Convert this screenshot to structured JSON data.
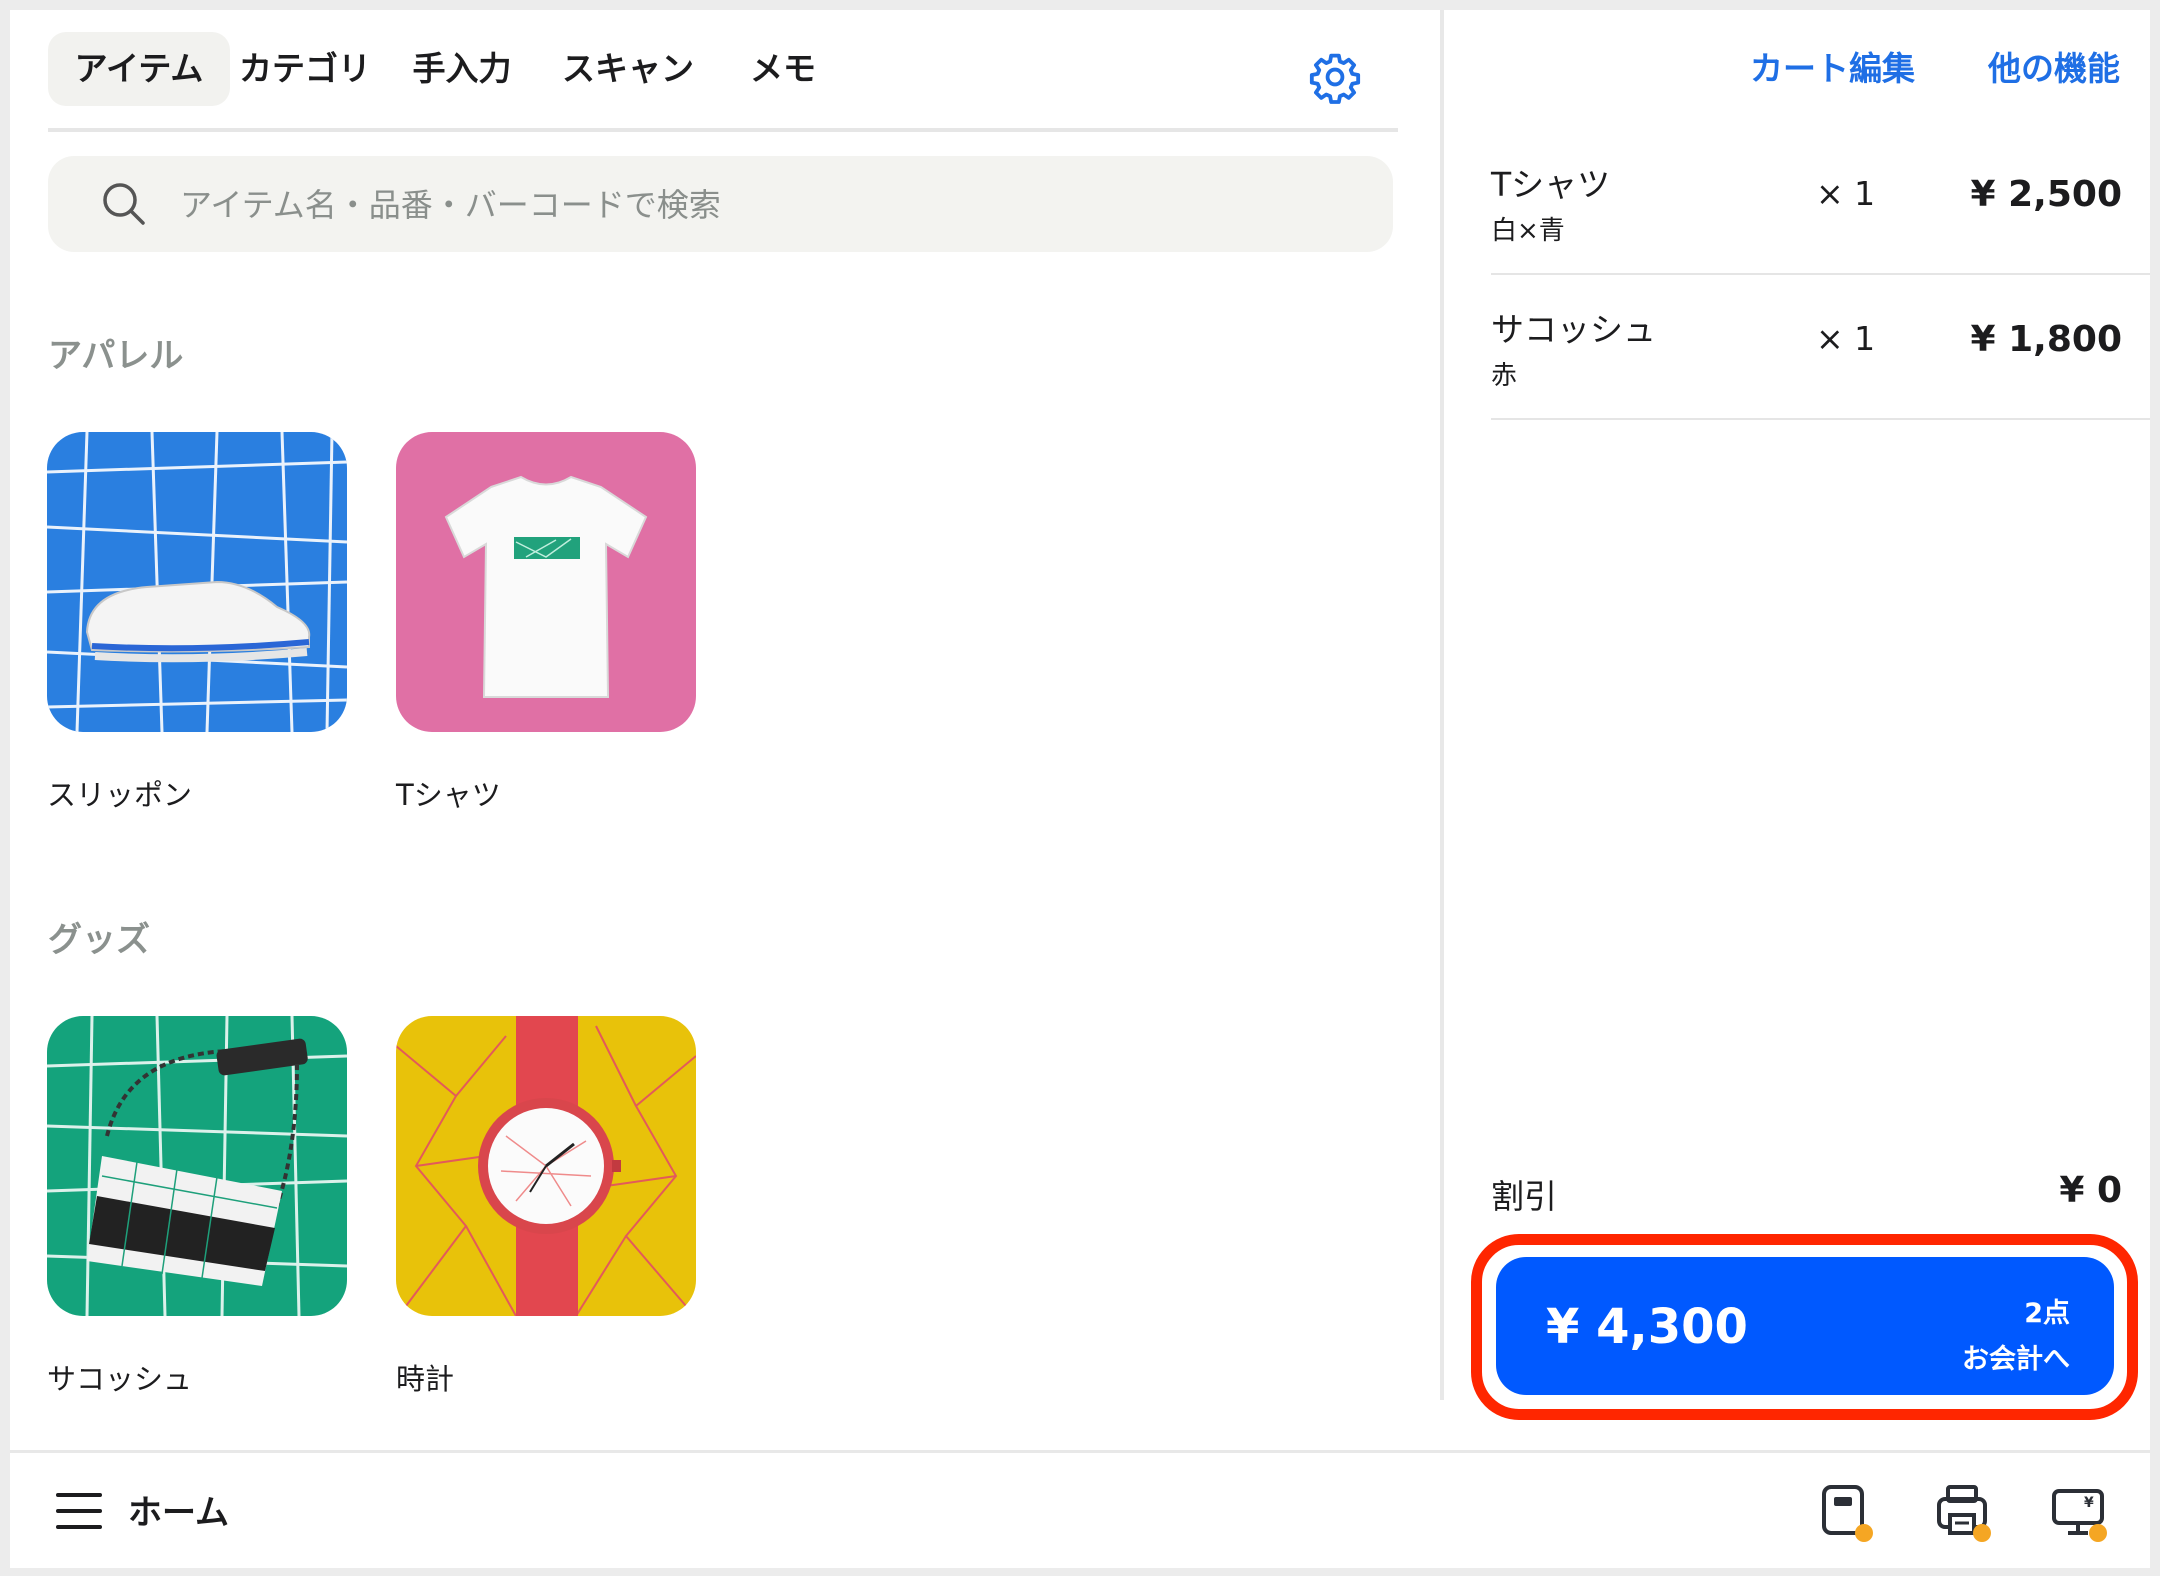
{
  "tabs": [
    {
      "label": "アイテム",
      "active": true
    },
    {
      "label": "カテゴリ"
    },
    {
      "label": "手入力"
    },
    {
      "label": "スキャン"
    },
    {
      "label": "メモ"
    }
  ],
  "search": {
    "placeholder": "アイテム名・品番・バーコードで検索"
  },
  "sections": [
    {
      "title": "アパレル",
      "items": [
        {
          "name": "スリッポン"
        },
        {
          "name": "Tシャツ"
        }
      ]
    },
    {
      "title": "グッズ",
      "items": [
        {
          "name": "サコッシュ"
        },
        {
          "name": "時計"
        }
      ]
    }
  ],
  "cart": {
    "edit_label": "カート編集",
    "more_label": "他の機能",
    "items": [
      {
        "name": "Tシャツ",
        "variant": "白×青",
        "qty": "× 1",
        "price": "¥ 2,500"
      },
      {
        "name": "サコッシュ",
        "variant": "赤",
        "qty": "× 1",
        "price": "¥ 1,800"
      }
    ],
    "discount_label": "割引",
    "discount_value": "¥ 0",
    "checkout": {
      "total": "¥ 4,300",
      "count": "2点",
      "action": "お会計へ"
    }
  },
  "bottom_bar": {
    "home_label": "ホーム",
    "icons": [
      "card-reader-icon",
      "receipt-printer-icon",
      "customer-display-icon"
    ],
    "status_color": "#f5a623"
  },
  "colors": {
    "accent": "#1f6fe5",
    "checkout": "#0059ff",
    "highlight": "#ff2600"
  }
}
